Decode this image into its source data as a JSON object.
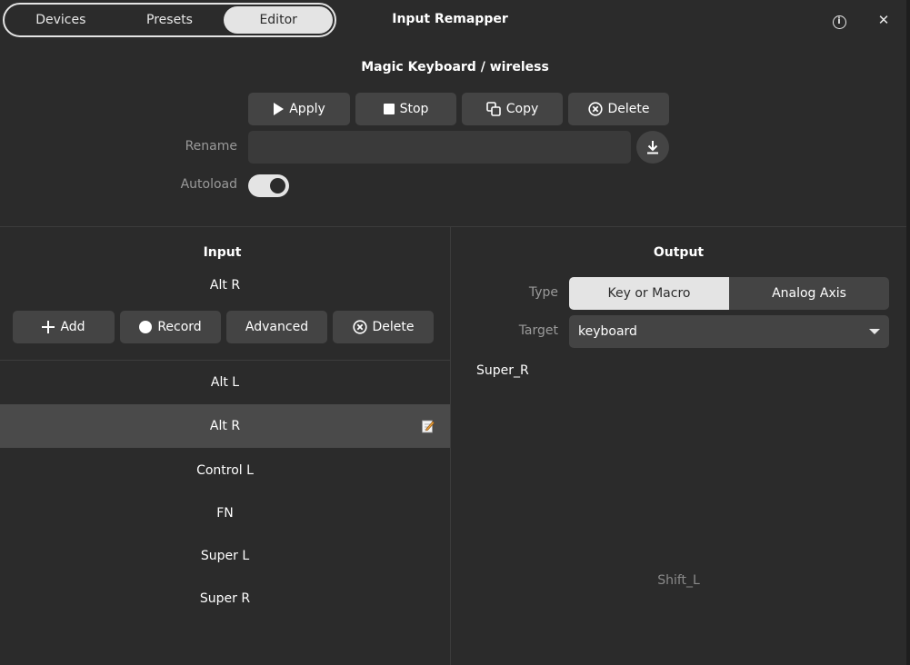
{
  "header": {
    "tabs": [
      {
        "label": "Devices"
      },
      {
        "label": "Presets"
      },
      {
        "label": "Editor"
      }
    ],
    "title": "Input Remapper"
  },
  "preset": {
    "device": "Magic Keyboard",
    "separator": "/",
    "name": "wireless",
    "actions": {
      "apply": "Apply",
      "stop": "Stop",
      "copy": "Copy",
      "delete": "Delete"
    },
    "rename_label": "Rename",
    "rename_value": "",
    "autoload_label": "Autoload",
    "autoload_on": true
  },
  "input": {
    "title": "Input",
    "current": "Alt R",
    "buttons": {
      "add": "Add",
      "record": "Record",
      "advanced": "Advanced",
      "delete": "Delete"
    },
    "mappings": [
      {
        "label": "Alt L"
      },
      {
        "label": "Alt R"
      },
      {
        "label": "Control L"
      },
      {
        "label": "FN"
      },
      {
        "label": "Super L"
      },
      {
        "label": "Super R"
      }
    ],
    "selected_index": 1
  },
  "output": {
    "title": "Output",
    "type_label": "Type",
    "type_options": [
      "Key or Macro",
      "Analog Axis"
    ],
    "type_selected": "Key or Macro",
    "target_label": "Target",
    "target_value": "keyboard",
    "code": "Super_R",
    "placeholder": "Shift_L"
  },
  "colors": {
    "background": "#2b2b2b",
    "button": "#444444",
    "active": "#e4e4e4",
    "selected_row": "#4a4a4a",
    "muted_text": "#9a9a9a"
  }
}
